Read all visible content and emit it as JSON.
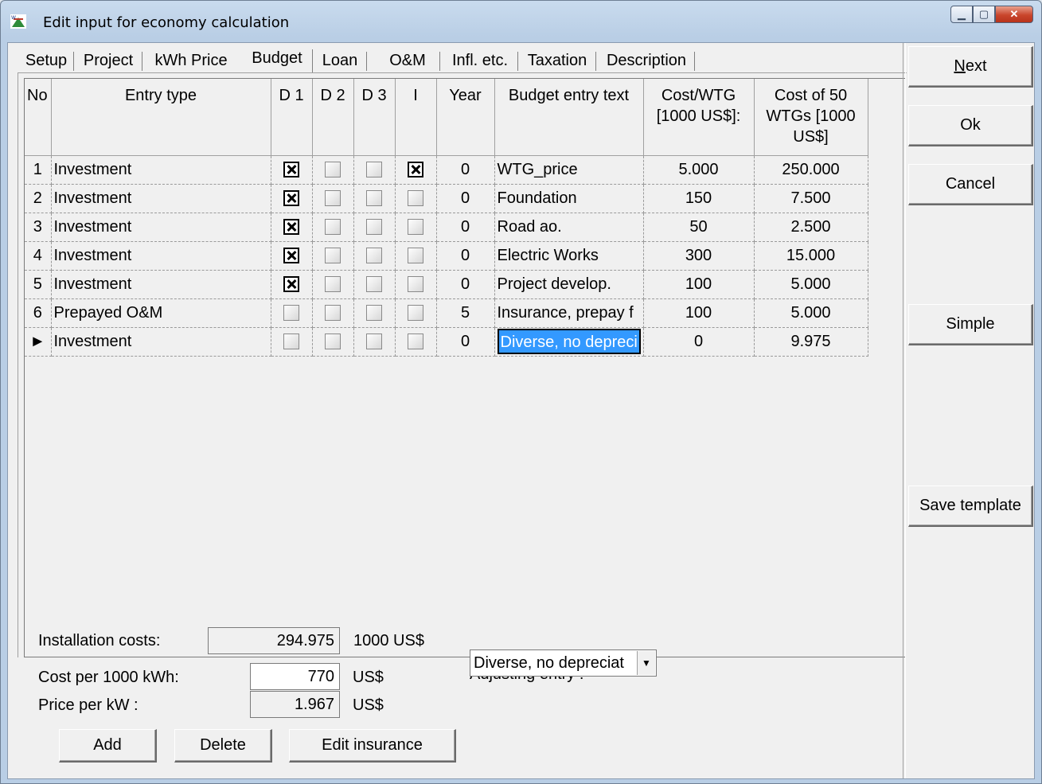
{
  "window": {
    "title": "Edit input for economy calculation"
  },
  "tabs": [
    {
      "label": "Setup",
      "active": false
    },
    {
      "label": "Project",
      "active": false
    },
    {
      "label": "kWh Price",
      "active": false
    },
    {
      "label": "Budget",
      "active": true
    },
    {
      "label": "Loan",
      "active": false
    },
    {
      "label": "O&M",
      "active": false
    },
    {
      "label": "Infl. etc.",
      "active": false
    },
    {
      "label": "Taxation",
      "active": false
    },
    {
      "label": "Description",
      "active": false
    }
  ],
  "grid": {
    "headers": {
      "no": "No",
      "entry_type": "Entry type",
      "d1": "D 1",
      "d2": "D 2",
      "d3": "D 3",
      "i": "I",
      "year": "Year",
      "text": "Budget entry text",
      "cost_wtg": "Cost/WTG [1000 US$]:",
      "cost_total": "Cost of 50 WTGs [1000 US$]"
    },
    "rows": [
      {
        "no": "1",
        "type": "Investment",
        "d1": true,
        "d2": false,
        "d3": false,
        "i": true,
        "year": "0",
        "text": "WTG_price",
        "cost_wtg": "5.000",
        "cost_total": "250.000"
      },
      {
        "no": "2",
        "type": "Investment",
        "d1": true,
        "d2": false,
        "d3": false,
        "i": false,
        "year": "0",
        "text": "Foundation",
        "cost_wtg": "150",
        "cost_total": "7.500"
      },
      {
        "no": "3",
        "type": "Investment",
        "d1": true,
        "d2": false,
        "d3": false,
        "i": false,
        "year": "0",
        "text": "Road ao.",
        "cost_wtg": "50",
        "cost_total": "2.500"
      },
      {
        "no": "4",
        "type": "Investment",
        "d1": true,
        "d2": false,
        "d3": false,
        "i": false,
        "year": "0",
        "text": "Electric Works",
        "cost_wtg": "300",
        "cost_total": "15.000"
      },
      {
        "no": "5",
        "type": "Investment",
        "d1": true,
        "d2": false,
        "d3": false,
        "i": false,
        "year": "0",
        "text": "Project develop.",
        "cost_wtg": "100",
        "cost_total": "5.000"
      },
      {
        "no": "6",
        "type": "Prepayed O&M",
        "d1": false,
        "d2": false,
        "d3": false,
        "i": false,
        "year": "5",
        "text": "Insurance, prepay f",
        "cost_wtg": "100",
        "cost_total": "5.000"
      },
      {
        "no": "►",
        "type": "Investment",
        "d1": false,
        "d2": false,
        "d3": false,
        "i": false,
        "year": "0",
        "text": "Diverse, no depreci",
        "cost_wtg": "0",
        "cost_total": "9.975"
      }
    ]
  },
  "summary": {
    "installation_label": "Installation costs:",
    "installation_value": "294.975",
    "installation_unit": "1000 US$",
    "cost_per_kwh_label": "Cost per 1000 kWh:",
    "cost_per_kwh_value": "770",
    "cost_per_kwh_unit": "US$",
    "price_per_kw_label": "Price per kW :",
    "price_per_kw_value": "1.967",
    "price_per_kw_unit": "US$",
    "adjusting_label": "Adjusting entry :",
    "adjusting_value": "Diverse, no depreciat"
  },
  "buttons": {
    "add": "Add",
    "delete": "Delete",
    "edit_insurance": "Edit insurance",
    "next": "Next",
    "ok": "Ok",
    "cancel": "Cancel",
    "simple": "Simple",
    "save_template": "Save template"
  }
}
